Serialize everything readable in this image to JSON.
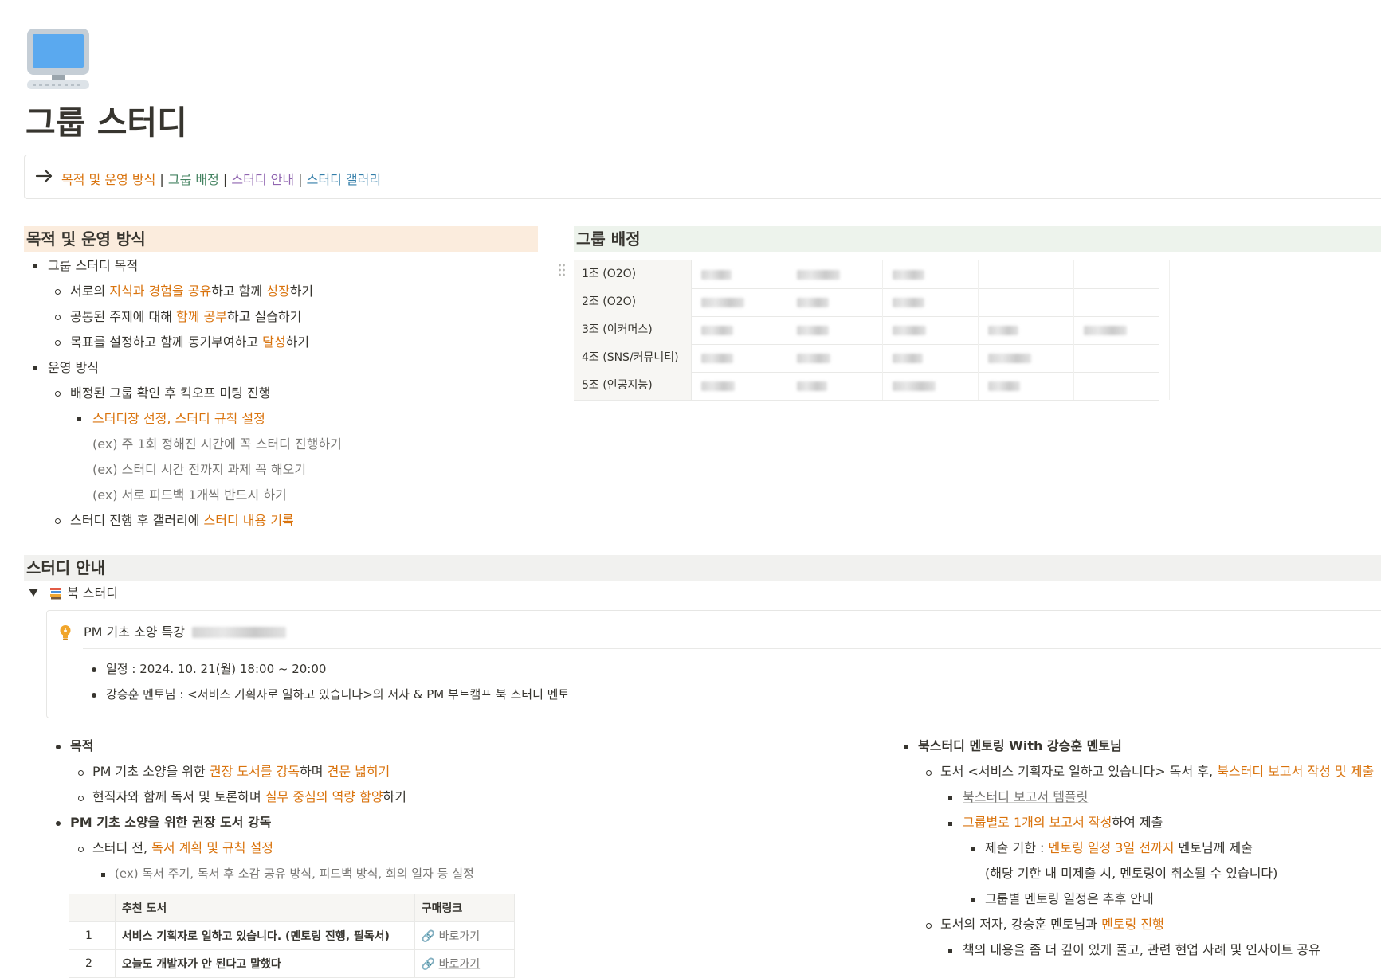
{
  "title": "그룹 스터디",
  "page_icon": "computer-icon",
  "toc": {
    "items": [
      "목적 및 운영 방식",
      "그룹 배정",
      "스터디 안내",
      "스터디 갤러리"
    ],
    "separator": " | "
  },
  "purpose": {
    "heading": "목적 및 운영 방식",
    "goal_label": "그룹 스터디 목적",
    "goals": [
      {
        "a": "서로의 ",
        "h": "지식과 경험을 공유",
        "b": "하고 함께 ",
        "h2": "성장",
        "c": "하기"
      },
      {
        "a": "공통된 주제에 대해 ",
        "h": "함께 공부",
        "b": "하고 실습하기"
      },
      {
        "a": "목표를 설정하고 함께 동기부여하고 ",
        "h": "달성",
        "b": "하기"
      }
    ],
    "ops_label": "운영 방식",
    "ops_1": "배정된 그룹 확인 후 킥오프 미팅 진행",
    "ops_1_sub": "스터디장 선정, 스터디 규칙 설정",
    "examples": [
      "(ex) 주 1회 정해진 시간에 꼭 스터디 진행하기",
      "(ex) 스터디 시간 전까지 과제 꼭 해오기",
      "(ex) 서로 피드백 1개씩 반드시 하기"
    ],
    "ops_2_a": "스터디 진행 후 갤러리에 ",
    "ops_2_h": "스터디 내용 기록"
  },
  "groups": {
    "heading": "그룹 배정",
    "rows": [
      {
        "name": "1조 (O2O)",
        "members": 3
      },
      {
        "name": "2조 (O2O)",
        "members": 3
      },
      {
        "name": "3조 (이커머스)",
        "members": 5
      },
      {
        "name": "4조 (SNS/커뮤니티)",
        "members": 4
      },
      {
        "name": "5조 (인공지능)",
        "members": 4
      }
    ]
  },
  "study": {
    "heading": "스터디 안내",
    "toggle_label": "북 스터디",
    "callout_title": "PM 기초 소양 특강",
    "callout_items": [
      "일정 : 2024. 10. 21(월) 18:00 ~ 20:00",
      "강승훈 멘토님 : <서비스 기획자로 일하고 있습니다>의 저자 & PM 부트캠프 북 스터디 멘토"
    ],
    "left": {
      "purpose_label": "목적",
      "p1_a": "PM 기초 소양을 위한 ",
      "p1_h": "권장 도서를 강독",
      "p1_b": "하며 ",
      "p1_h2": "견문 넓히기",
      "p2_a": "현직자와 함께 독서 및 토론하며 ",
      "p2_h": "실무 중심의 역량 함양",
      "p2_b": "하기",
      "reading_label": "PM 기초 소양을 위한 권장 도서 강독",
      "r1_a": "스터디 전, ",
      "r1_h": "독서 계획 및 규칙 설정",
      "r1_sub": "(ex) 독서 주기, 독서 후 소감 공유 방식, 피드백 방식, 회의 일자 등 설정"
    },
    "books": {
      "headers": [
        "",
        "추천 도서",
        "구매링크"
      ],
      "rows": [
        {
          "no": "1",
          "title": "서비스 기획자로 일하고 있습니다. (멘토링 진행, 필독서)",
          "link": "바로가기"
        },
        {
          "no": "2",
          "title": "오늘도 개발자가 안 된다고 말했다",
          "link": "바로가기"
        }
      ]
    },
    "right": {
      "label": "북스터디 멘토링 With 강승훈 멘토님",
      "m1_a": "도서 <서비스 기획자로 일하고 있습니다> 독서 후, ",
      "m1_h": "북스터디 보고서 작성 및 제출",
      "template_link": "북스터디 보고서 템플릿",
      "m1_s2_h": "그룹별로 1개의 보고서 작성",
      "m1_s2_b": "하여 제출",
      "due_a": "제출 기한 : ",
      "due_h": "멘토링 일정 3일 전까지",
      "due_b": " 멘토님께 제출",
      "due_note": "(해당 기한 내 미제출 시, 멘토링이 취소될 수 있습니다)",
      "schedule": "그룹별 멘토링 일정은 추후 안내",
      "m2_a": "도서의 저자, 강승훈 멘토님과 ",
      "m2_h": "멘토링 진행",
      "m2_sub": "책의 내용을 좀 더 깊이 있게 풀고, 관련 현업 사례 및 인사이트 공유"
    }
  },
  "colors": {
    "orange": "#d9730d",
    "green": "#448361",
    "purple": "#9065b0",
    "blue": "#337ea9"
  }
}
